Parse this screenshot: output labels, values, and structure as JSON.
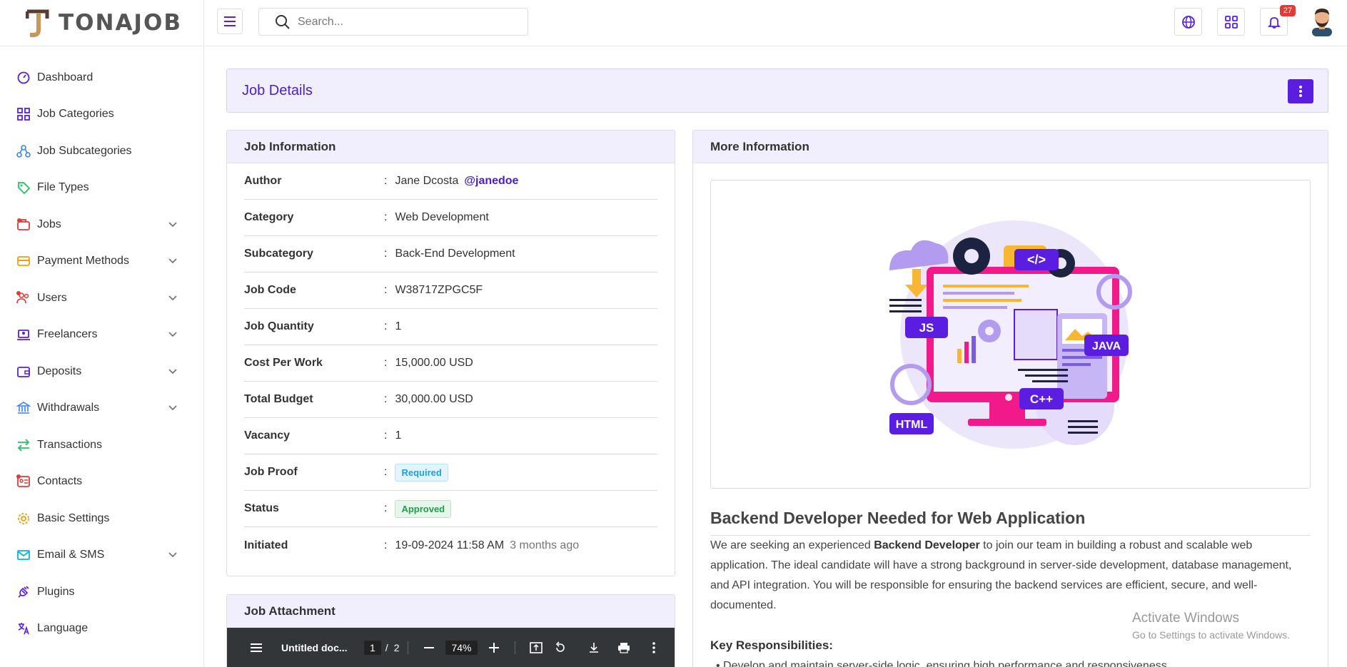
{
  "brand": {
    "name": "TONAJOB"
  },
  "sidebar": {
    "items": [
      {
        "label": "Dashboard",
        "icon": "dashboard-gauge-icon",
        "color": "#5b1ee0",
        "submenu": false
      },
      {
        "label": "Job Categories",
        "icon": "grid-icon",
        "color": "#5b1ee0",
        "submenu": false
      },
      {
        "label": "Job Subcategories",
        "icon": "hierarchy-icon",
        "color": "#3b82f6",
        "submenu": false
      },
      {
        "label": "File Types",
        "icon": "tag-icon",
        "color": "#22c55e",
        "submenu": false
      },
      {
        "label": "Jobs",
        "icon": "briefcase-icon",
        "color": "#e53935",
        "submenu": true
      },
      {
        "label": "Payment Methods",
        "icon": "credit-card-icon",
        "color": "#f59e0b",
        "submenu": true
      },
      {
        "label": "Users",
        "icon": "users-icon",
        "color": "#e53935",
        "submenu": true
      },
      {
        "label": "Freelancers",
        "icon": "laptop-user-icon",
        "color": "#5b1ee0",
        "submenu": true
      },
      {
        "label": "Deposits",
        "icon": "wallet-icon",
        "color": "#5b1ee0",
        "submenu": true
      },
      {
        "label": "Withdrawals",
        "icon": "bank-icon",
        "color": "#3b82f6",
        "submenu": true
      },
      {
        "label": "Transactions",
        "icon": "arrows-exchange-icon",
        "color": "#22c55e",
        "submenu": false
      },
      {
        "label": "Contacts",
        "icon": "contact-card-icon",
        "color": "#e53935",
        "submenu": false
      },
      {
        "label": "Basic Settings",
        "icon": "gear-icon",
        "color": "#f59e0b",
        "submenu": false
      },
      {
        "label": "Email & SMS",
        "icon": "envelope-icon",
        "color": "#06b6d4",
        "submenu": true
      },
      {
        "label": "Plugins",
        "icon": "plug-icon",
        "color": "#5b1ee0",
        "submenu": false
      },
      {
        "label": "Language",
        "icon": "translate-icon",
        "color": "#5b1ee0",
        "submenu": false
      }
    ]
  },
  "header": {
    "search_placeholder": "Search...",
    "notification_count": "27"
  },
  "page": {
    "title": "Job Details"
  },
  "job_info": {
    "title": "Job Information",
    "rows": [
      {
        "key": "Author",
        "value": "Jane Dcosta",
        "extra": "@janedoe"
      },
      {
        "key": "Category",
        "value": "Web Development"
      },
      {
        "key": "Subcategory",
        "value": "Back-End Development"
      },
      {
        "key": "Job Code",
        "value": "W38717ZPGC5F"
      },
      {
        "key": "Job Quantity",
        "value": "1"
      },
      {
        "key": "Cost Per Work",
        "value": "15,000.00 USD"
      },
      {
        "key": "Total Budget",
        "value": "30,000.00 USD"
      },
      {
        "key": "Vacancy",
        "value": "1"
      },
      {
        "key": "Job Proof",
        "value": "Required",
        "pill": "info"
      },
      {
        "key": "Status",
        "value": "Approved",
        "pill": "ok"
      },
      {
        "key": "Initiated",
        "value": "19-09-2024 11:58 AM",
        "muted": "3 months ago"
      }
    ]
  },
  "attachment": {
    "title": "Job Attachment",
    "doc_title": "Untitled doc...",
    "page": "1",
    "pages": "2",
    "zoom": "74%"
  },
  "more_info": {
    "title": "More Information",
    "job_title": "Backend Developer Needed for Web Application",
    "desc_pre": "We are seeking an experienced ",
    "desc_bold": "Backend Developer",
    "desc_post": " to join our team in building a robust and scalable web application. The ideal candidate will have a strong background in server-side development, database management, and API integration. You will be responsible for ensuring the backend services are efficient, secure, and well-documented.",
    "resp_heading": "Key Responsibilities:",
    "resp_first": "Develop and maintain server-side logic, ensuring high performance and responsiveness",
    "illustration_labels": [
      "JS",
      "HTML",
      "JAVA",
      "C++",
      "</>"
    ]
  },
  "watermark": {
    "line1": "Activate Windows",
    "line2": "Go to Settings to activate Windows."
  }
}
